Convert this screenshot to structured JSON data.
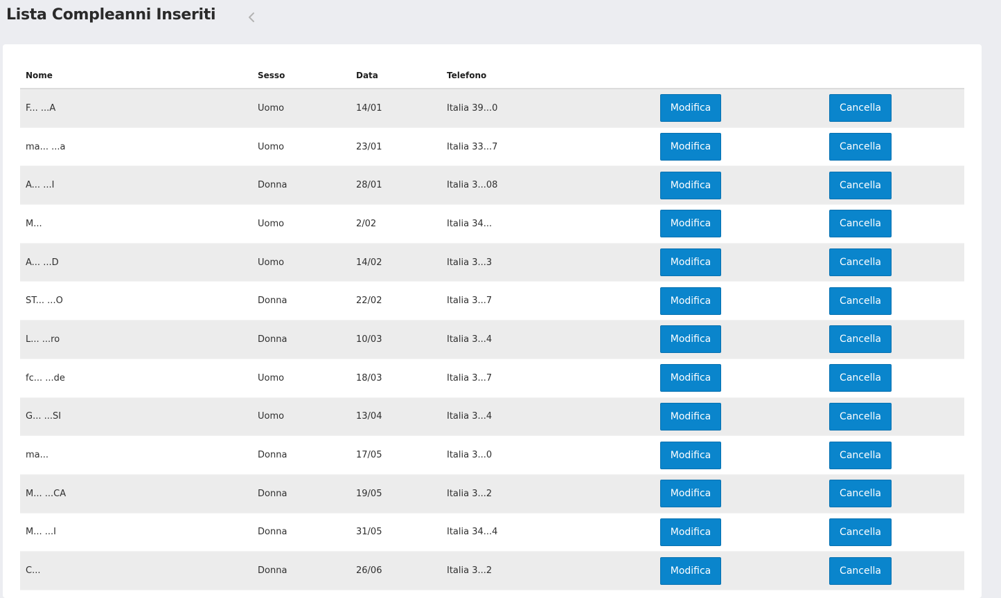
{
  "header": {
    "title": "Lista Compleanni Inseriti",
    "back_icon": "chevron-left-icon"
  },
  "table": {
    "columns": [
      "Nome",
      "Sesso",
      "Data",
      "Telefono",
      "",
      ""
    ],
    "modify_label": "Modifica",
    "delete_label": "Cancella",
    "accent_color": "#0a85cc",
    "rows": [
      {
        "nome": "F... ...A",
        "sesso": "Uomo",
        "data": "14/01",
        "telefono": "Italia 39...0"
      },
      {
        "nome": "ma... ...a",
        "sesso": "Uomo",
        "data": "23/01",
        "telefono": "Italia 33...7"
      },
      {
        "nome": "A... ...I",
        "sesso": "Donna",
        "data": "28/01",
        "telefono": "Italia 3...08"
      },
      {
        "nome": "M...",
        "sesso": "Uomo",
        "data": "2/02",
        "telefono": "Italia 34..."
      },
      {
        "nome": "A... ...D",
        "sesso": "Uomo",
        "data": "14/02",
        "telefono": "Italia 3...3"
      },
      {
        "nome": "ST... ...O",
        "sesso": "Donna",
        "data": "22/02",
        "telefono": "Italia 3...7"
      },
      {
        "nome": "L... ...ro",
        "sesso": "Donna",
        "data": "10/03",
        "telefono": "Italia 3...4"
      },
      {
        "nome": "fc... ...de",
        "sesso": "Uomo",
        "data": "18/03",
        "telefono": "Italia 3...7"
      },
      {
        "nome": "G... ...SI",
        "sesso": "Uomo",
        "data": "13/04",
        "telefono": "Italia 3...4"
      },
      {
        "nome": "ma...",
        "sesso": "Donna",
        "data": "17/05",
        "telefono": "Italia 3...0"
      },
      {
        "nome": "M... ...CA",
        "sesso": "Donna",
        "data": "19/05",
        "telefono": "Italia 3...2"
      },
      {
        "nome": "M... ...I",
        "sesso": "Donna",
        "data": "31/05",
        "telefono": "Italia 34...4"
      },
      {
        "nome": "C...",
        "sesso": "Donna",
        "data": "26/06",
        "telefono": "Italia 3...2"
      }
    ]
  }
}
